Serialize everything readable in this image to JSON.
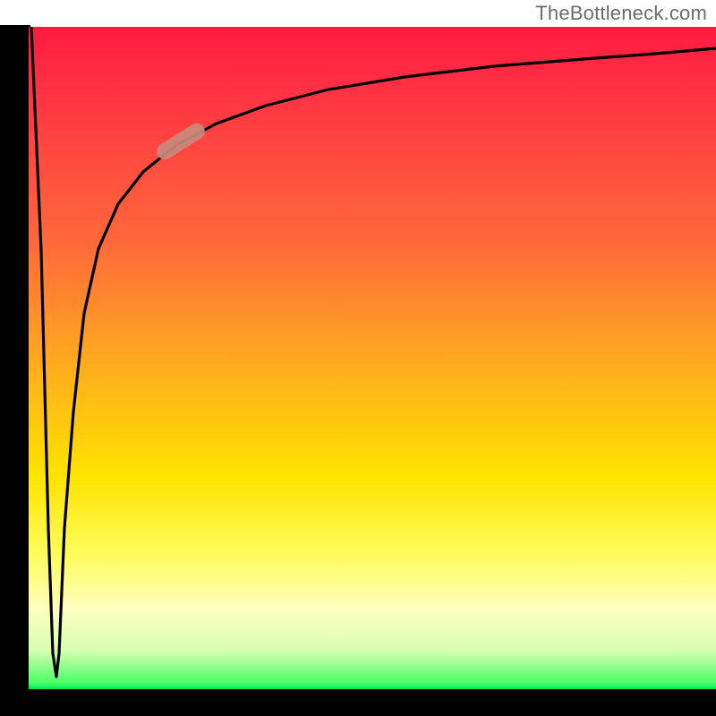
{
  "watermark": "TheBottleneck.com",
  "colors": {
    "axis": "#000000",
    "curve": "#000000",
    "marker": "#c98a7c",
    "gradient_top": "#ff1a40",
    "gradient_bottom": "#00e85a"
  },
  "chart_data": {
    "type": "line",
    "title": "",
    "xlabel": "",
    "ylabel": "",
    "xlim": [
      0,
      100
    ],
    "ylim": [
      0,
      100
    ],
    "grid": false,
    "legend": false,
    "annotations": [],
    "background_gradient": {
      "direction": "vertical",
      "meaning": "green at bottom (good) to red at top (bad)",
      "stops": [
        {
          "pos": 0,
          "color": "#ff1a40"
        },
        {
          "pos": 33,
          "color": "#ff6a3a"
        },
        {
          "pos": 50,
          "color": "#ffa81f"
        },
        {
          "pos": 68,
          "color": "#ffe400"
        },
        {
          "pos": 88,
          "color": "#fdffc0"
        },
        {
          "pos": 99,
          "color": "#4cff6a"
        },
        {
          "pos": 100,
          "color": "#00e85a"
        }
      ]
    },
    "series": [
      {
        "name": "bottleneck-curve",
        "note": "Composite curve: sharp spike from top-left down to near-origin, then asymptotic rise toward top-right. Values estimated from plot; axes unlabeled.",
        "x": [
          0.5,
          1.5,
          2.8,
          3.2,
          3.6,
          4.2,
          4.8,
          5.5,
          6.5,
          8,
          10,
          13,
          17,
          22,
          28,
          36,
          46,
          58,
          72,
          86,
          100
        ],
        "y": [
          100,
          60,
          10,
          2,
          10,
          30,
          45,
          55,
          63,
          70,
          75,
          79,
          83,
          86,
          89,
          91,
          93,
          94.5,
          95.5,
          96.3,
          97
        ]
      }
    ],
    "marker": {
      "name": "highlight-pill",
      "shape": "rounded-capsule",
      "center_x": 22,
      "center_y": 86,
      "angle_deg": 35,
      "length": 8,
      "color": "#c98a7c"
    }
  }
}
